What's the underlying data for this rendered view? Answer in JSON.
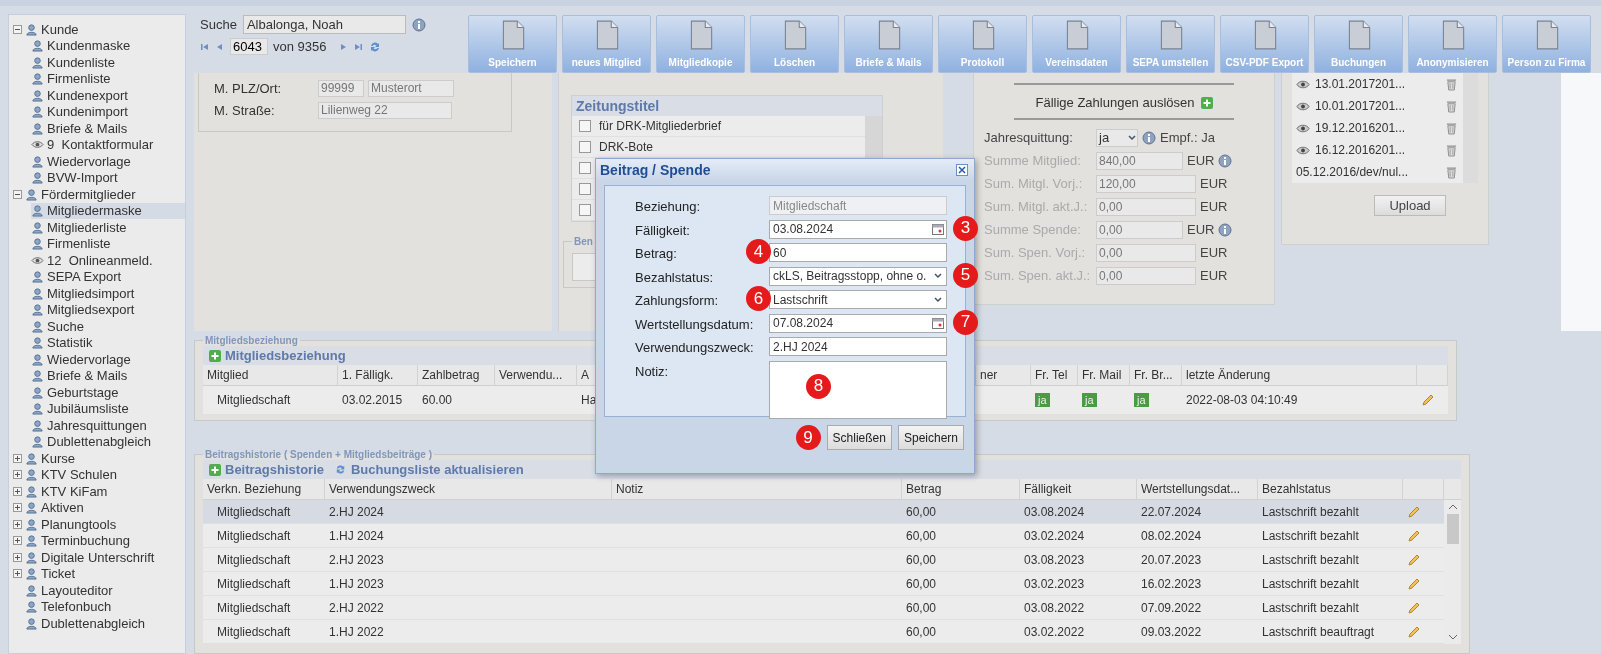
{
  "sidebar": {
    "items": [
      {
        "label": "Kunde",
        "expanded": true,
        "selected": false,
        "children": [
          {
            "label": "Kundenmaske",
            "selected": false
          },
          {
            "label": "Kundenliste",
            "selected": false
          },
          {
            "label": "Firmenliste",
            "selected": false
          },
          {
            "label": "Kundenexport",
            "selected": false
          },
          {
            "label": "Kundenimport",
            "selected": false
          },
          {
            "label": "Briefe & Mails",
            "selected": false
          },
          {
            "label": "Kontaktformular",
            "count": "9",
            "selected": false
          },
          {
            "label": "Wiedervorlage",
            "selected": false
          },
          {
            "label": "BVW-Import",
            "selected": false
          }
        ]
      },
      {
        "label": "Fördermitglieder",
        "expanded": true,
        "selected": false,
        "children": [
          {
            "label": "Mitgliedermaske",
            "selected": true
          },
          {
            "label": "Mitgliederliste",
            "selected": false
          },
          {
            "label": "Firmenliste",
            "selected": false
          },
          {
            "label": "Onlineanmeld.",
            "count": "12",
            "selected": false
          },
          {
            "label": "SEPA Export",
            "selected": false
          },
          {
            "label": "Mitgliedsimport",
            "selected": false
          },
          {
            "label": "Mitgliedsexport",
            "selected": false
          },
          {
            "label": "Suche",
            "selected": false
          },
          {
            "label": "Statistik",
            "selected": false
          },
          {
            "label": "Wiedervorlage",
            "selected": false
          },
          {
            "label": "Briefe & Mails",
            "selected": false
          },
          {
            "label": "Geburtstage",
            "selected": false
          },
          {
            "label": "Jubiläumsliste",
            "selected": false
          },
          {
            "label": "Jahresquittungen",
            "selected": false
          },
          {
            "label": "Dublettenabgleich",
            "selected": false
          }
        ]
      },
      {
        "label": "Kurse",
        "expanded": false,
        "selected": false
      },
      {
        "label": "KTV Schulen",
        "expanded": false,
        "selected": false
      },
      {
        "label": "KTV KiFam",
        "expanded": false,
        "selected": false
      },
      {
        "label": "Aktiven",
        "expanded": false,
        "selected": false
      },
      {
        "label": "Planungtools",
        "expanded": false,
        "selected": false
      },
      {
        "label": "Terminbuchung",
        "expanded": false,
        "selected": false
      },
      {
        "label": "Digitale Unterschrift",
        "expanded": false,
        "selected": false
      },
      {
        "label": "Ticket",
        "expanded": false,
        "selected": false
      },
      {
        "label": "Layouteditor",
        "selected": false
      },
      {
        "label": "Telefonbuch",
        "selected": false
      },
      {
        "label": "Dublettenabgleich",
        "selected": false
      }
    ]
  },
  "search": {
    "label": "Suche",
    "value": "Albalonga, Noah",
    "record": "6043",
    "total": "von 9356"
  },
  "toolbar": [
    "Speichern",
    "neues Mitglied",
    "Mitgliedkopie",
    "Löschen",
    "Briefe & Mails",
    "Protokoll",
    "Vereinsdaten",
    "SEPA umstellen",
    "CSV-PDF Export",
    "Buchungen",
    "Anonymisieren",
    "Person zu Firma"
  ],
  "address": [
    {
      "label": "M. PLZ/Ort:",
      "values": [
        "99999",
        "Musterort"
      ]
    },
    {
      "label": "M. Straße:",
      "values": [
        "Lilienweg 22"
      ]
    }
  ],
  "newspapers": {
    "title": "Zeitungstitel",
    "items": [
      {
        "label": "für DRK-Mitgliederbrief",
        "checked": false
      },
      {
        "label": "DRK-Bote",
        "checked": false
      },
      {
        "checked": false
      },
      {
        "checked": false
      },
      {
        "checked": false
      }
    ]
  },
  "ben_fieldset": {
    "legend": "Ben"
  },
  "payments": {
    "trigger": "Fällige Zahlungen auslösen",
    "receipt": {
      "label": "Jahresquittung:",
      "value": "ja",
      "recipient": "Empf.: Ja"
    },
    "sums": [
      {
        "label": "Summe Mitglied:",
        "value": "840,00",
        "unit": "EUR",
        "info": true
      },
      {
        "label": "Sum. Mitgl. Vorj.:",
        "value": "120,00",
        "unit": "EUR",
        "info": false
      },
      {
        "label": "Sum. Mitgl. akt.J.:",
        "value": "0,00",
        "unit": "EUR",
        "info": false
      },
      {
        "label": "Summe Spende:",
        "value": "0,00",
        "unit": "EUR",
        "info": true
      },
      {
        "label": "Sum. Spen. Vorj.:",
        "value": "0,00",
        "unit": "EUR",
        "info": false
      },
      {
        "label": "Sum. Spen. akt.J.:",
        "value": "0,00",
        "unit": "EUR",
        "info": false
      }
    ]
  },
  "files": {
    "items": [
      {
        "name": "13.01.2017201...",
        "viewable": true
      },
      {
        "name": "10.01.2017201...",
        "viewable": true
      },
      {
        "name": "19.12.2016201...",
        "viewable": true
      },
      {
        "name": "16.12.2016201...",
        "viewable": true
      },
      {
        "name": "05.12.2016/dev/nul...",
        "viewable": false
      }
    ],
    "upload": "Upload"
  },
  "membership": {
    "legend": "Mitgliedsbeziehung",
    "title": "Mitgliedsbeziehung",
    "columns": [
      {
        "label": "Mitglied",
        "kind": "text"
      },
      {
        "label": "1. Fälligk.",
        "kind": "text"
      },
      {
        "label": "Zahlbetrag",
        "kind": "text"
      },
      {
        "label": "Verwendu...",
        "kind": "text"
      },
      {
        "label": "A",
        "kind": "text"
      },
      {
        "kind": "text"
      },
      {
        "label": "ner",
        "kind": "text"
      },
      {
        "label": "Fr. Tel",
        "kind": "badge"
      },
      {
        "label": "Fr. Mail",
        "kind": "badge"
      },
      {
        "label": "Fr. Br...",
        "kind": "badge"
      },
      {
        "label": "letzte Änderung",
        "kind": "text"
      },
      {
        "kind": "edit"
      }
    ],
    "rows": [
      {
        "cells": [
          "Mitgliedschaft",
          "03.02.2015",
          "60.00",
          null,
          "Ha",
          null,
          null,
          "ja",
          "ja",
          "ja",
          "2022-08-03 04:10:49",
          null
        ]
      }
    ]
  },
  "history": {
    "legend": "Beitragshistorie ( Spenden + Mitgliedsbeiträge )",
    "title": "Beitragshistorie",
    "refresh": "Buchungsliste aktualisieren",
    "columns": [
      "Verkn. Beziehung",
      "Verwendungszweck",
      "Notiz",
      "Betrag",
      "Fälligkeit",
      "Wertstellungsdat...",
      "Bezahlstatus"
    ],
    "rows": [
      {
        "cells": [
          "Mitgliedschaft",
          "2.HJ 2024",
          null,
          "60,00",
          "03.08.2024",
          "22.07.2024",
          "Lastschrift bezahlt"
        ],
        "selected": true
      },
      {
        "cells": [
          "Mitgliedschaft",
          "1.HJ 2024",
          null,
          "60,00",
          "03.02.2024",
          "08.02.2024",
          "Lastschrift bezahlt"
        ],
        "selected": false
      },
      {
        "cells": [
          "Mitgliedschaft",
          "2.HJ 2023",
          null,
          "60,00",
          "03.08.2023",
          "20.07.2023",
          "Lastschrift bezahlt"
        ],
        "selected": false
      },
      {
        "cells": [
          "Mitgliedschaft",
          "1.HJ 2023",
          null,
          "60,00",
          "03.02.2023",
          "16.02.2023",
          "Lastschrift bezahlt"
        ],
        "selected": false
      },
      {
        "cells": [
          "Mitgliedschaft",
          "2.HJ 2022",
          null,
          "60,00",
          "03.08.2022",
          "07.09.2022",
          "Lastschrift bezahlt"
        ],
        "selected": false
      },
      {
        "cells": [
          "Mitgliedschaft",
          "1.HJ 2022",
          null,
          "60,00",
          "03.02.2022",
          "09.03.2022",
          "Lastschrift beauftragt"
        ],
        "selected": false
      }
    ]
  },
  "dialog": {
    "title": "Beitrag / Spende",
    "fields": [
      {
        "label": "Beziehung:",
        "kind": "text",
        "value": "Mitgliedschaft",
        "disabled": true
      },
      {
        "label": "Fälligkeit:",
        "kind": "date",
        "value": "03.08.2024",
        "disabled": false,
        "marker": "3"
      },
      {
        "label": "Betrag:",
        "kind": "text",
        "value": "60",
        "disabled": false,
        "marker": "4"
      },
      {
        "label": "Bezahlstatus:",
        "kind": "select",
        "value": "ckLS, Beitragsstopp, ohne o.",
        "disabled": false,
        "marker": "5"
      },
      {
        "label": "Zahlungsform:",
        "kind": "select",
        "value": "Lastschrift",
        "disabled": false,
        "marker": "6"
      },
      {
        "label": "Wertstellungsdatum:",
        "kind": "date",
        "value": "07.08.2024",
        "disabled": false,
        "marker": "7"
      },
      {
        "label": "Verwendungszweck:",
        "kind": "text",
        "value": "2.HJ 2024",
        "disabled": false
      },
      {
        "label": "Notiz:",
        "kind": "textarea",
        "disabled": false,
        "marker": "8"
      }
    ],
    "buttons": [
      "Schließen",
      "Speichern"
    ],
    "button_marker": "9"
  }
}
